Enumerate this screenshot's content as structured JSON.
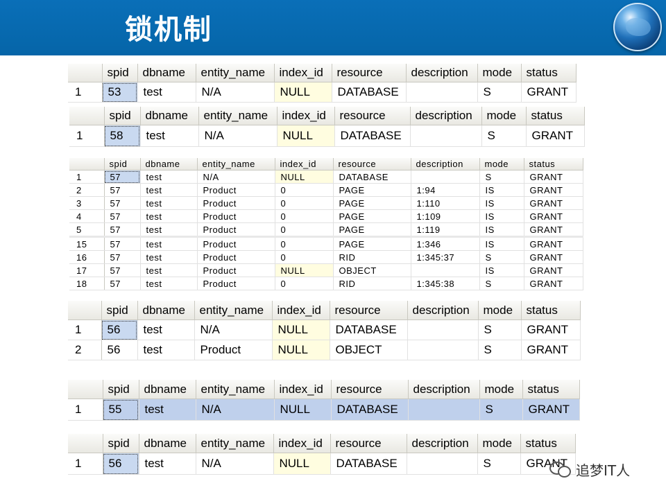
{
  "slide": {
    "title": "锁机制",
    "watermark": "追梦IT人"
  },
  "columns": [
    "spid",
    "dbname",
    "entity_name",
    "index_id",
    "resource",
    "description",
    "mode",
    "status"
  ],
  "grid1": {
    "rows": [
      [
        "1",
        "53",
        "test",
        "N/A",
        "NULL",
        "DATABASE",
        "",
        "S",
        "GRANT"
      ]
    ]
  },
  "grid2": {
    "rows": [
      [
        "1",
        "58",
        "test",
        "N/A",
        "NULL",
        "DATABASE",
        "",
        "S",
        "GRANT"
      ]
    ]
  },
  "grid3": {
    "rows": [
      [
        "1",
        "57",
        "test",
        "N/A",
        "NULL",
        "DATABASE",
        "",
        "S",
        "GRANT"
      ],
      [
        "2",
        "57",
        "test",
        "Product",
        "0",
        "PAGE",
        "1:94",
        "IS",
        "GRANT"
      ],
      [
        "3",
        "57",
        "test",
        "Product",
        "0",
        "PAGE",
        "1:110",
        "IS",
        "GRANT"
      ],
      [
        "4",
        "57",
        "test",
        "Product",
        "0",
        "PAGE",
        "1:109",
        "IS",
        "GRANT"
      ],
      [
        "5",
        "57",
        "test",
        "Product",
        "0",
        "PAGE",
        "1:119",
        "IS",
        "GRANT"
      ],
      [
        "15",
        "57",
        "test",
        "Product",
        "0",
        "PAGE",
        "1:346",
        "IS",
        "GRANT"
      ],
      [
        "16",
        "57",
        "test",
        "Product",
        "0",
        "RID",
        "1:345:37",
        "S",
        "GRANT"
      ],
      [
        "17",
        "57",
        "test",
        "Product",
        "NULL",
        "OBJECT",
        "",
        "IS",
        "GRANT"
      ],
      [
        "18",
        "57",
        "test",
        "Product",
        "0",
        "RID",
        "1:345:38",
        "S",
        "GRANT"
      ]
    ]
  },
  "grid4": {
    "rows": [
      [
        "1",
        "56",
        "test",
        "N/A",
        "NULL",
        "DATABASE",
        "",
        "S",
        "GRANT"
      ],
      [
        "2",
        "56",
        "test",
        "Product",
        "NULL",
        "OBJECT",
        "",
        "S",
        "GRANT"
      ]
    ]
  },
  "grid5": {
    "rows": [
      [
        "1",
        "55",
        "test",
        "N/A",
        "NULL",
        "DATABASE",
        "",
        "S",
        "GRANT"
      ]
    ]
  },
  "grid6": {
    "rows": [
      [
        "1",
        "56",
        "test",
        "N/A",
        "NULL",
        "DATABASE",
        "",
        "S",
        "GRANT"
      ]
    ]
  }
}
